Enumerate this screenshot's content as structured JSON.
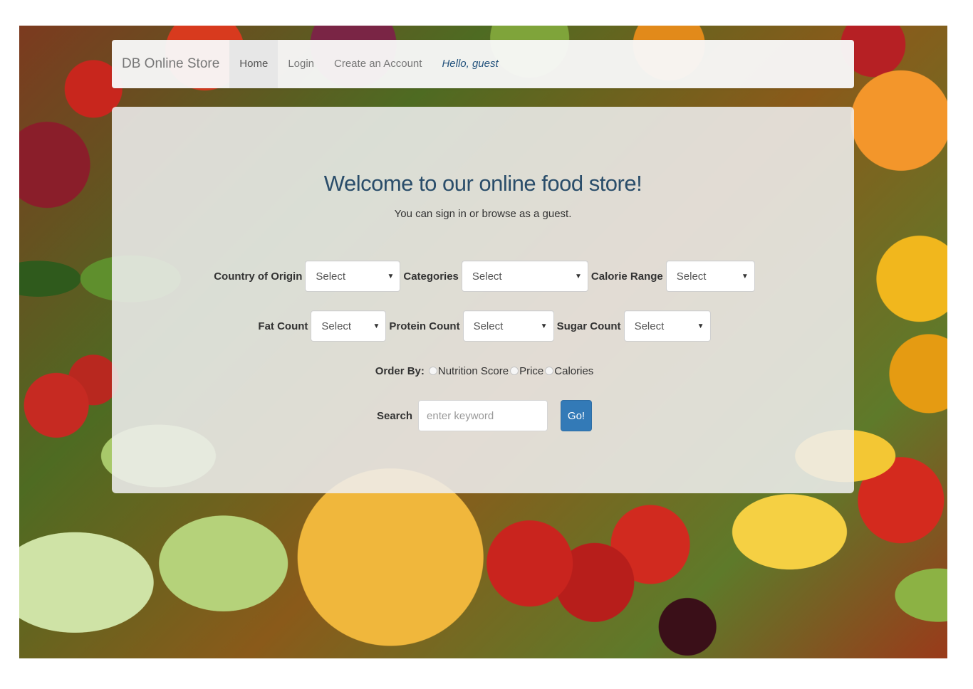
{
  "navbar": {
    "brand": "DB Online Store",
    "items": [
      {
        "label": "Home",
        "active": true
      },
      {
        "label": "Login",
        "active": false
      },
      {
        "label": "Create an Account",
        "active": false
      }
    ],
    "greeting": "Hello, guest"
  },
  "main": {
    "title": "Welcome to our online food store!",
    "subtitle": "You can sign in or browse as a guest."
  },
  "filters": {
    "country_label": "Country of Origin",
    "country_value": "Select",
    "categories_label": "Categories",
    "categories_value": "Select",
    "calorie_label": "Calorie Range",
    "calorie_value": "Select",
    "fat_label": "Fat Count",
    "fat_value": "Select",
    "protein_label": "Protein Count",
    "protein_value": "Select",
    "sugar_label": "Sugar Count",
    "sugar_value": "Select"
  },
  "order_by": {
    "label": "Order By:",
    "options": [
      "Nutrition Score",
      "Price",
      "Calories"
    ]
  },
  "search": {
    "label": "Search",
    "placeholder": "enter keyword",
    "button_label": "Go!"
  },
  "colors": {
    "accent": "#337ab7",
    "title": "#2a4d6a",
    "greeting": "#23527c"
  }
}
